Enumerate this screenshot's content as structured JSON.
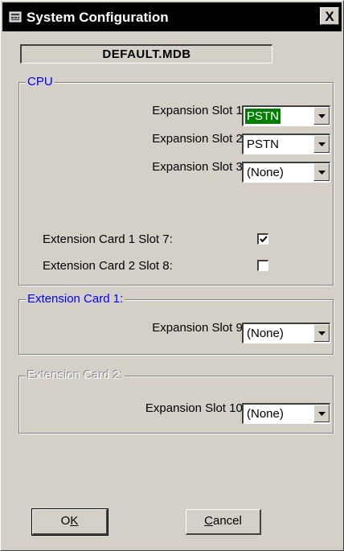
{
  "window": {
    "title": "System Configuration",
    "close_label": "X",
    "database_name": "DEFAULT.MDB"
  },
  "cpu_group": {
    "legend": "CPU",
    "slots": [
      {
        "label": "Expansion Slot 1:",
        "value": "PSTN",
        "selected": true
      },
      {
        "label": "Expansion Slot 2:",
        "value": "PSTN",
        "selected": false
      },
      {
        "label": "Expansion Slot 3:",
        "value": "(None)",
        "selected": false
      }
    ],
    "extension_cards": [
      {
        "label": "Extension Card 1 Slot 7:",
        "checked": true
      },
      {
        "label": "Extension Card 2 Slot 8:",
        "checked": false
      }
    ]
  },
  "ext_card1_group": {
    "legend": "Extension Card 1:",
    "legend_color": "#0000ff",
    "slot": {
      "label": "Expansion Slot 9:",
      "value": "(None)"
    }
  },
  "ext_card2_group": {
    "legend": "Extension Card 2:",
    "legend_state": "disabled",
    "slot": {
      "label": "Expansion Slot 10:",
      "value": "(None)"
    }
  },
  "buttons": {
    "ok_label": "OK",
    "ok_mnemonic_rest": "K",
    "ok_mnemonic": "O",
    "cancel_mnemonic": "C",
    "cancel_rest": "ancel"
  },
  "colors": {
    "face": "#d4d0c8",
    "titlebar": "#000000",
    "selection": "#008000"
  }
}
